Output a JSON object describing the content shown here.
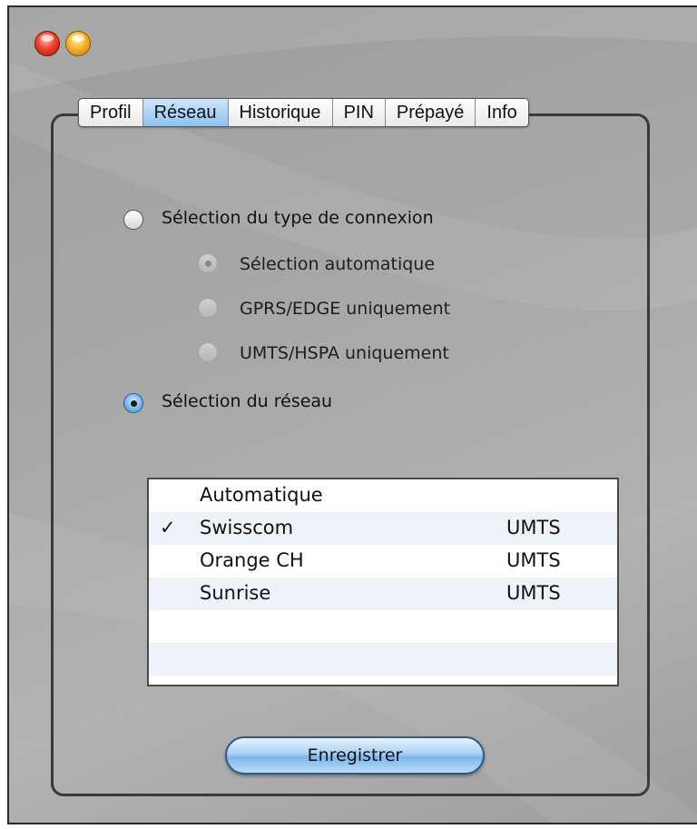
{
  "window": {
    "controls": [
      "close-icon",
      "minimize-icon"
    ],
    "colors": {
      "background": "#a6a6a6",
      "accent": "#8ec2f0",
      "close": "#f0412e",
      "minimize": "#f7b32a"
    }
  },
  "tabs": [
    {
      "label": "Profil",
      "active": false
    },
    {
      "label": "Réseau",
      "active": true
    },
    {
      "label": "Historique",
      "active": false
    },
    {
      "label": "PIN",
      "active": false
    },
    {
      "label": "Prépayé",
      "active": false
    },
    {
      "label": "Info",
      "active": false
    }
  ],
  "connection": {
    "type_option": {
      "label": "Sélection du type de connexion",
      "selected": false
    },
    "sub_options": [
      {
        "label": "Sélection automatique",
        "selected": true,
        "enabled": false
      },
      {
        "label": "GPRS/EDGE uniquement",
        "selected": false,
        "enabled": false
      },
      {
        "label": "UMTS/HSPA uniquement",
        "selected": false,
        "enabled": false
      }
    ],
    "network_option": {
      "label": "Sélection du réseau",
      "selected": true
    }
  },
  "networks": {
    "rows": [
      {
        "check": "",
        "name": "Automatique",
        "tech": ""
      },
      {
        "check": "✓",
        "name": "Swisscom",
        "tech": "UMTS"
      },
      {
        "check": "",
        "name": "Orange CH",
        "tech": "UMTS"
      },
      {
        "check": "",
        "name": "Sunrise",
        "tech": "UMTS"
      },
      {
        "check": "",
        "name": "",
        "tech": ""
      },
      {
        "check": "",
        "name": "",
        "tech": ""
      }
    ]
  },
  "save_button": {
    "label": "Enregistrer"
  }
}
